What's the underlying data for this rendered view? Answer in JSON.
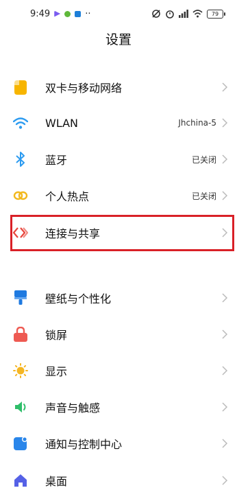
{
  "status_bar": {
    "time": "9:49",
    "more": "··",
    "battery_level": "79"
  },
  "page_title": "设置",
  "items": [
    {
      "label": "双卡与移动网络",
      "value": ""
    },
    {
      "label": "WLAN",
      "value": "Jhchina-5"
    },
    {
      "label": "蓝牙",
      "value": "已关闭"
    },
    {
      "label": "个人热点",
      "value": "已关闭"
    },
    {
      "label": "连接与共享",
      "value": ""
    },
    {
      "label": "壁纸与个性化",
      "value": ""
    },
    {
      "label": "锁屏",
      "value": ""
    },
    {
      "label": "显示",
      "value": ""
    },
    {
      "label": "声音与触感",
      "value": ""
    },
    {
      "label": "通知与控制中心",
      "value": ""
    },
    {
      "label": "桌面",
      "value": ""
    }
  ],
  "colors": {
    "sim": "#f7b500",
    "wlan": "#2c9bf0",
    "bluetooth": "#2c9bf0",
    "hotspot": "#f2b81c",
    "connect": "#e8453c",
    "wallpaper": "#1f7ae0",
    "lock": "#ee5a52",
    "display": "#f5b623",
    "sound": "#2fbe6a",
    "notify": "#2a86ea",
    "home": "#5561e6",
    "highlight": "#d92027"
  }
}
